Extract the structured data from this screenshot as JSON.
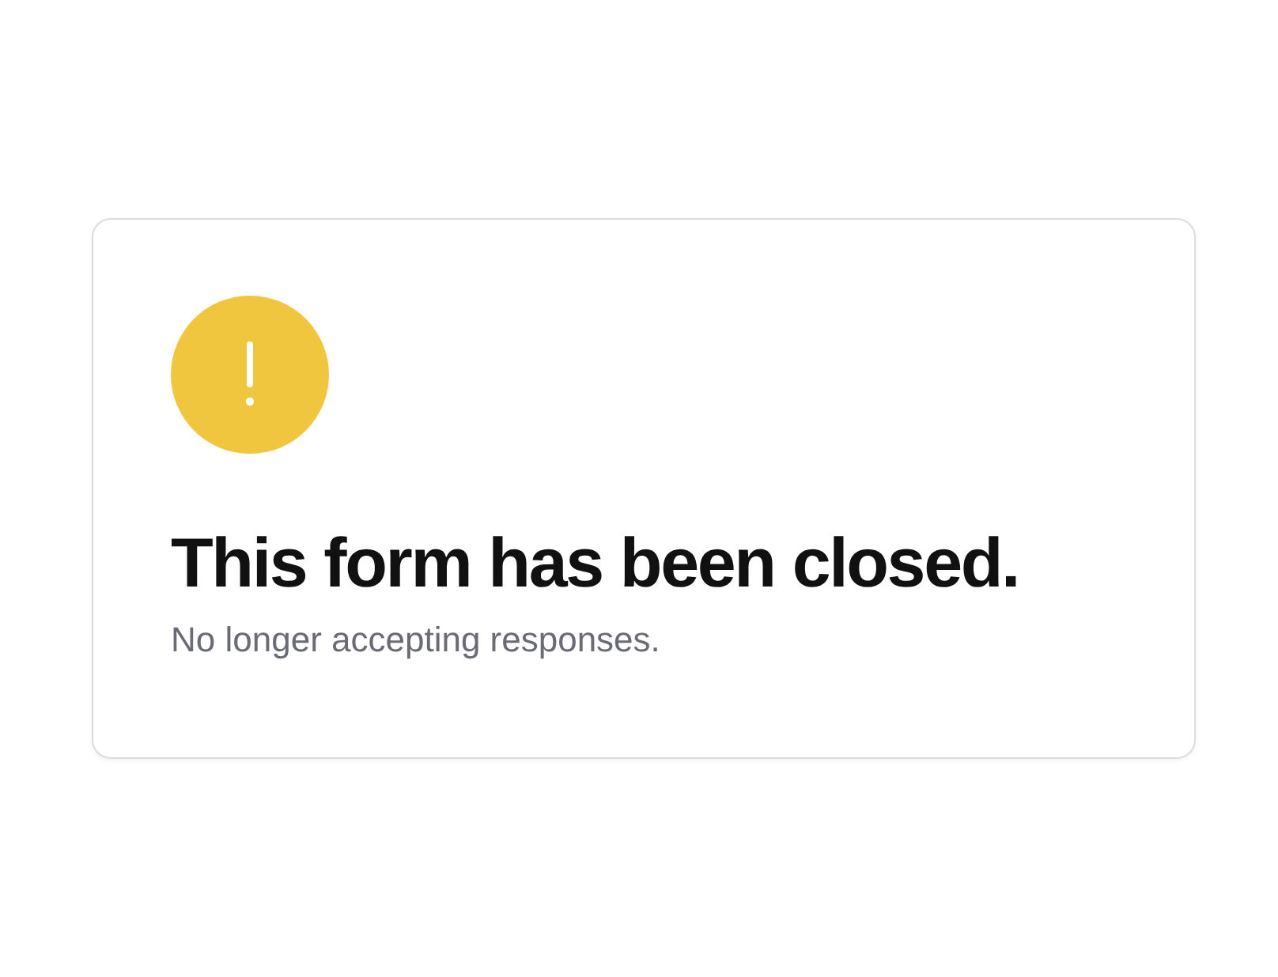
{
  "card": {
    "title": "This form has been closed.",
    "message": "No longer accepting responses."
  }
}
